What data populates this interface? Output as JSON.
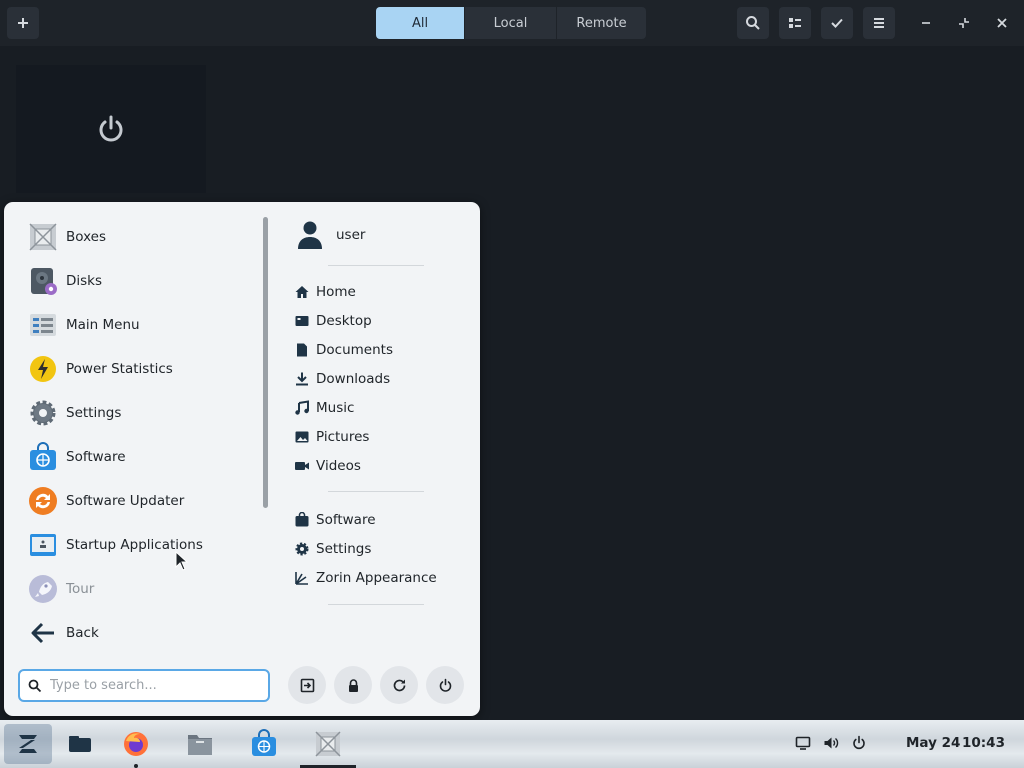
{
  "header": {
    "add_icon": "plus-icon",
    "tabs": [
      {
        "label": "All",
        "active": true
      },
      {
        "label": "Local",
        "active": false
      },
      {
        "label": "Remote",
        "active": false
      }
    ],
    "search_icon": "search-icon",
    "view_icon": "list-view-icon",
    "select_icon": "checkmark-icon",
    "menu_icon": "hamburger-icon",
    "window_controls": [
      "minimize-icon",
      "restore-icon",
      "close-icon"
    ]
  },
  "vm_tile": {
    "icon": "power-icon"
  },
  "menu": {
    "apps": [
      {
        "label": "Boxes",
        "icon": "boxes-icon"
      },
      {
        "label": "Disks",
        "icon": "disks-icon"
      },
      {
        "label": "Main Menu",
        "icon": "main-menu-icon"
      },
      {
        "label": "Power Statistics",
        "icon": "power-statistics-icon"
      },
      {
        "label": "Settings",
        "icon": "settings-gear-icon"
      },
      {
        "label": "Software",
        "icon": "software-bag-icon"
      },
      {
        "label": "Software Updater",
        "icon": "software-updater-icon"
      },
      {
        "label": "Startup Applications",
        "icon": "startup-applications-icon"
      },
      {
        "label": "Tour",
        "icon": "tour-rocket-icon"
      },
      {
        "label": "Back",
        "icon": "back-arrow-icon"
      }
    ],
    "user": {
      "label": "user",
      "icon": "user-avatar-icon"
    },
    "places": [
      {
        "label": "Home",
        "icon": "home-icon"
      },
      {
        "label": "Desktop",
        "icon": "desktop-icon"
      },
      {
        "label": "Documents",
        "icon": "document-icon"
      },
      {
        "label": "Downloads",
        "icon": "download-icon"
      },
      {
        "label": "Music",
        "icon": "music-icon"
      },
      {
        "label": "Pictures",
        "icon": "pictures-icon"
      },
      {
        "label": "Videos",
        "icon": "video-icon"
      }
    ],
    "shortcuts": [
      {
        "label": "Software",
        "icon": "bag-icon"
      },
      {
        "label": "Settings",
        "icon": "gear-icon"
      },
      {
        "label": "Zorin Appearance",
        "icon": "appearance-icon"
      }
    ],
    "search": {
      "placeholder": "Type to search...",
      "value": ""
    },
    "system_buttons": [
      "logout-icon",
      "lock-icon",
      "restart-icon",
      "power-icon"
    ]
  },
  "taskbar": {
    "apps": [
      "zorin-menu-icon",
      "workspaces-icon",
      "firefox-icon",
      "files-icon",
      "software-store-icon",
      "boxes-taskbar-icon"
    ],
    "tray": [
      "display-icon",
      "volume-icon",
      "power-icon"
    ],
    "date": "May 24",
    "time": "10:43"
  },
  "colors": {
    "accent": "#a9d4f3",
    "search_border": "#5aa8e6",
    "dark_bg": "#181d23",
    "menu_bg": "#f2f4f6"
  }
}
